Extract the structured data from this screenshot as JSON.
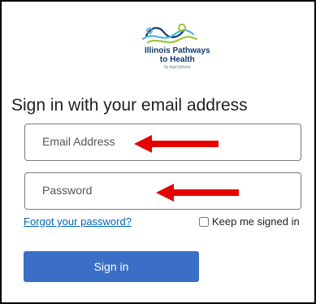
{
  "logo": {
    "line1": "Illinois Pathways",
    "line2": "to Health",
    "line3": "by AgeOptions",
    "icon": "wavy-lines-logo-icon"
  },
  "form": {
    "heading": "Sign in with your email address",
    "email_placeholder": "Email Address",
    "password_placeholder": "Password",
    "forgot_link": "Forgot your password?",
    "keep_signed_in_label": "Keep me signed in",
    "keep_signed_in_checked": false,
    "submit_label": "Sign in"
  },
  "annotations": {
    "arrow_icon": "red-left-arrow-icon"
  },
  "colors": {
    "accent": "#3b6fc7",
    "link": "#0067b8",
    "arrow": "#e60000",
    "logo_blue": "#123b6b",
    "logo_green": "#9cc43a",
    "logo_light_blue": "#4fb3d9"
  }
}
